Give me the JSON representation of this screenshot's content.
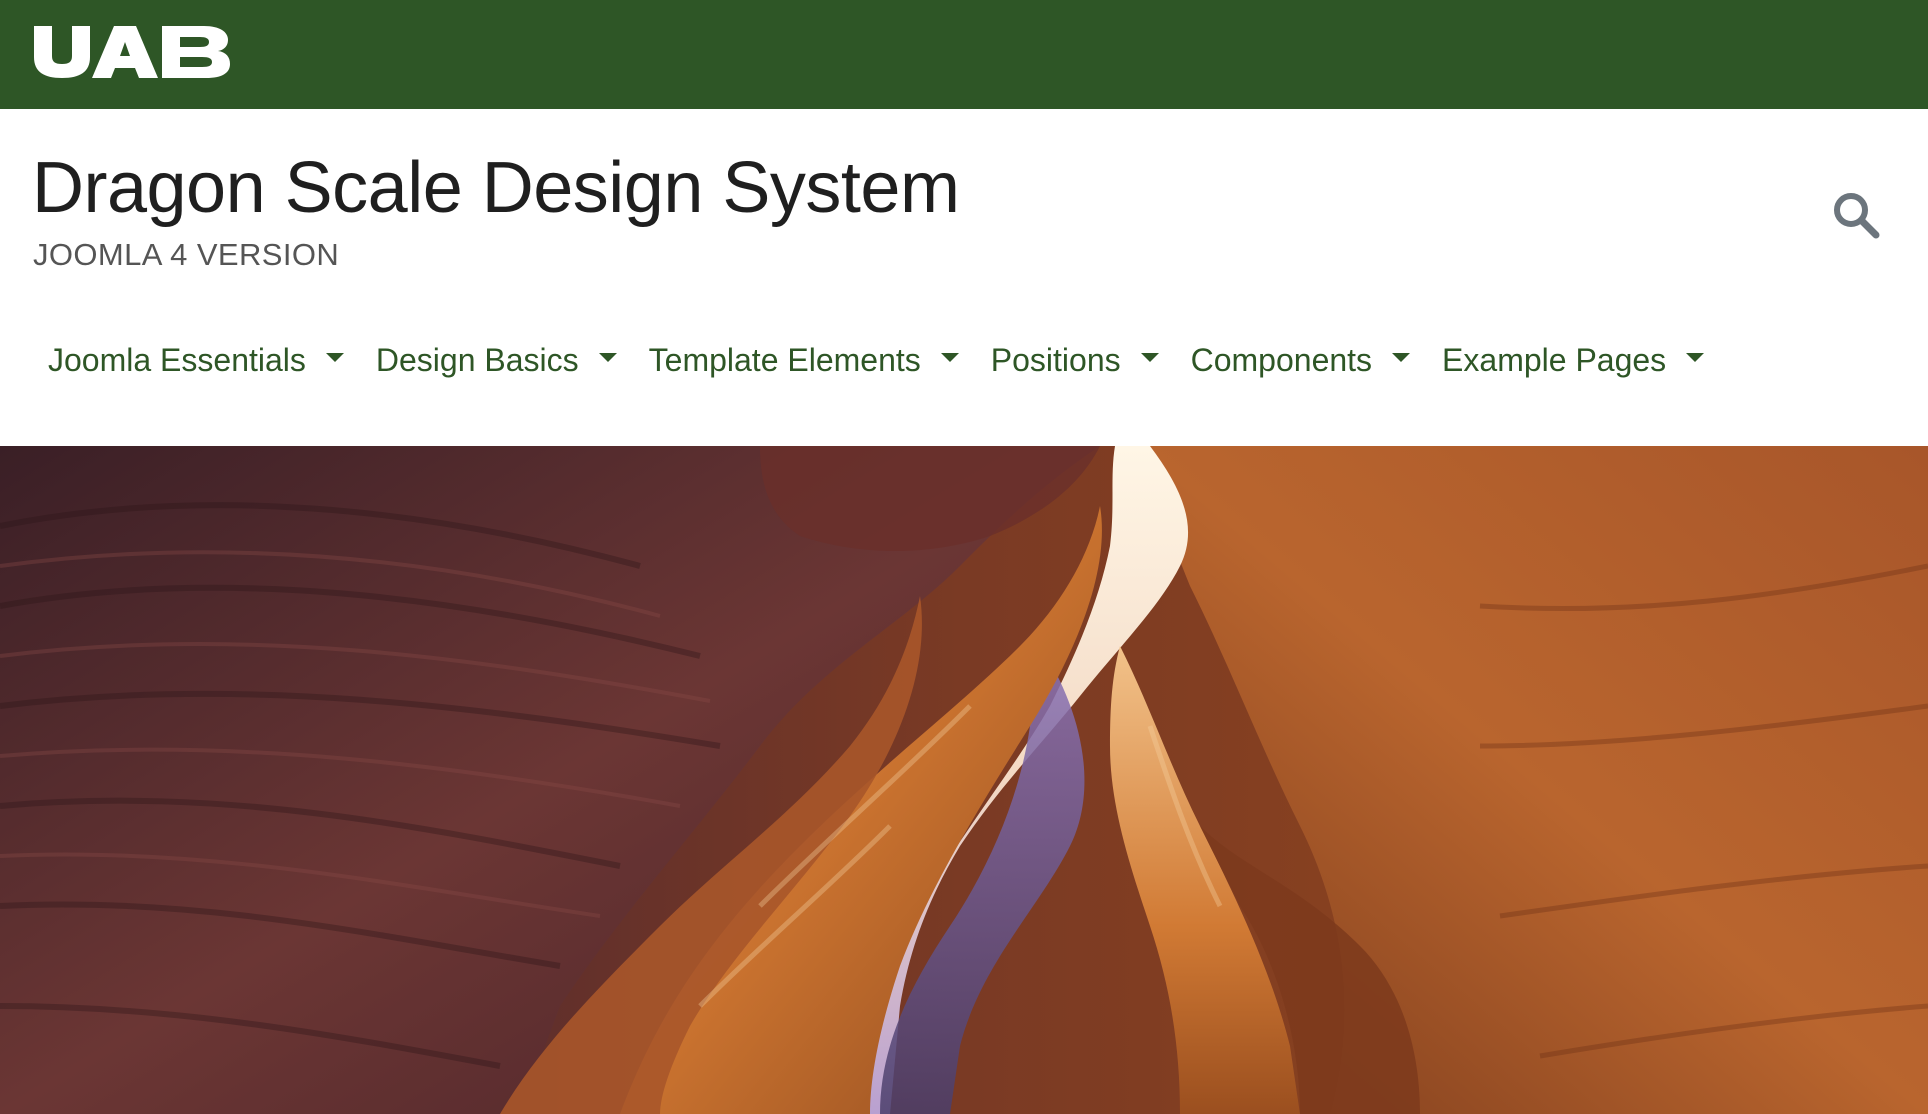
{
  "brand": {
    "logo_text": "UAB",
    "colors": {
      "primary_green": "#2e5626",
      "title_text": "#1f1f1f",
      "subtitle_text": "#555555",
      "search_icon": "#6c757d"
    }
  },
  "header": {
    "title": "Dragon Scale Design System",
    "subtitle": "JOOMLA 4 VERSION",
    "search_icon": "search-icon"
  },
  "nav": {
    "items": [
      {
        "label": "Joomla Essentials",
        "has_dropdown": true
      },
      {
        "label": "Design Basics",
        "has_dropdown": true
      },
      {
        "label": "Template Elements",
        "has_dropdown": true
      },
      {
        "label": "Positions",
        "has_dropdown": true
      },
      {
        "label": "Components",
        "has_dropdown": true
      },
      {
        "label": "Example Pages",
        "has_dropdown": true
      }
    ]
  },
  "hero": {
    "image_subject": "slot canyon sandstone"
  }
}
